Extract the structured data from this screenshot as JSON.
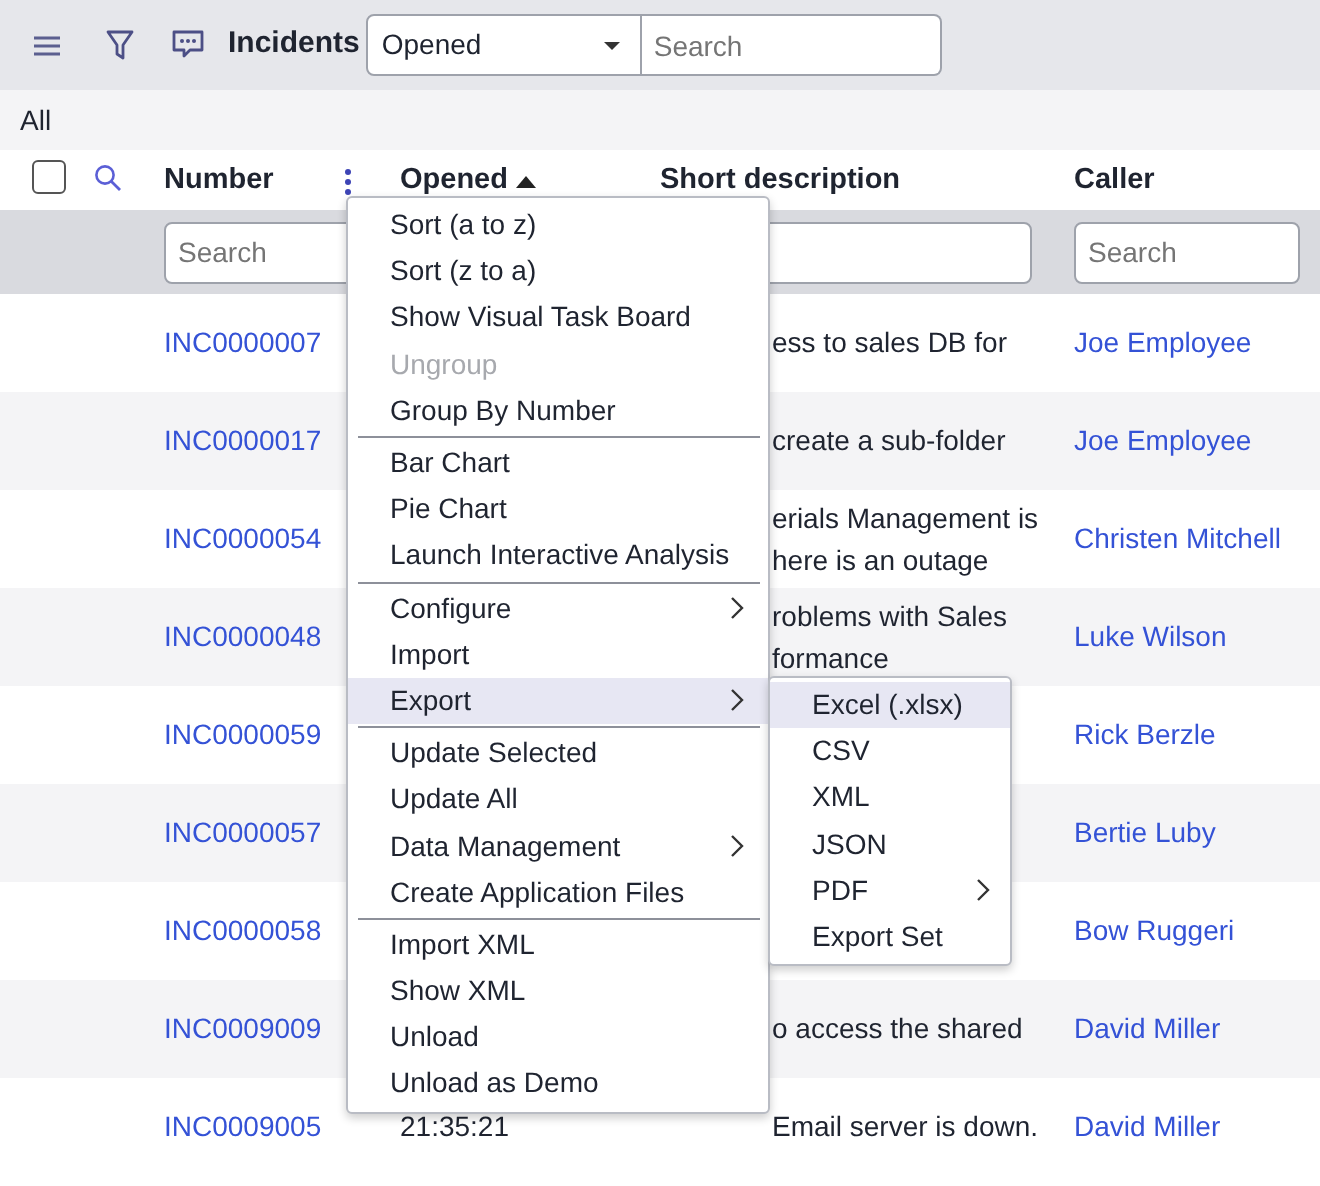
{
  "toolbar": {
    "title": "Incidents",
    "field_select": {
      "value": "Opened"
    },
    "search": {
      "placeholder": "Search"
    }
  },
  "breadcrumb": "All",
  "table": {
    "select_all": {
      "checked": false
    },
    "columns": [
      {
        "label": "Number",
        "sorted": false,
        "filter_placeholder": "Search"
      },
      {
        "label": "Opened",
        "sorted": true
      },
      {
        "label": "Short description",
        "sorted": false
      },
      {
        "label": "Caller",
        "sorted": false,
        "filter_placeholder": "Search"
      }
    ],
    "rows": [
      {
        "number": "INC0000007",
        "description": [
          "ess to sales DB for"
        ],
        "caller": "Joe Employee"
      },
      {
        "number": "INC0000017",
        "description": [
          "create a sub-folder"
        ],
        "caller": "Joe Employee"
      },
      {
        "number": "INC0000054",
        "description": [
          "erials Management is",
          "here is an outage"
        ],
        "caller": "Christen Mitchell"
      },
      {
        "number": "INC0000048",
        "description": [
          "roblems with Sales",
          "formance"
        ],
        "caller": "Luke Wilson"
      },
      {
        "number": "INC0000059",
        "caller": "Rick Berzle"
      },
      {
        "number": "INC0000057",
        "caller": "Bertie Luby"
      },
      {
        "number": "INC0000058",
        "caller": "Bow Ruggeri"
      },
      {
        "number": "INC0009009",
        "description": [
          "o access the shared"
        ],
        "caller": "David Miller"
      },
      {
        "number": "INC0009005",
        "opened": "21:35:21",
        "description": [
          "Email server is down."
        ],
        "caller": "David Miller"
      }
    ]
  },
  "context_menu": {
    "items": [
      {
        "label": "Sort (a to z)",
        "disabled": false,
        "submenu": false,
        "selected": false
      },
      {
        "label": "Sort (z to a)",
        "disabled": false,
        "submenu": false,
        "selected": false
      },
      {
        "label": "Show Visual Task Board",
        "disabled": false,
        "submenu": false,
        "selected": false
      },
      {
        "label": "Ungroup",
        "disabled": true,
        "submenu": false,
        "selected": false
      },
      {
        "label": "Group By Number",
        "disabled": false,
        "submenu": false,
        "selected": false
      },
      {
        "kind": "divider"
      },
      {
        "label": "Bar Chart",
        "disabled": false,
        "submenu": false,
        "selected": false
      },
      {
        "label": "Pie Chart",
        "disabled": false,
        "submenu": false,
        "selected": false
      },
      {
        "label": "Launch Interactive Analysis",
        "disabled": false,
        "submenu": false,
        "selected": false
      },
      {
        "kind": "divider"
      },
      {
        "label": "Configure",
        "disabled": false,
        "submenu": true,
        "selected": false
      },
      {
        "label": "Import",
        "disabled": false,
        "submenu": false,
        "selected": false
      },
      {
        "label": "Export",
        "disabled": false,
        "submenu": true,
        "selected": true,
        "children": [
          {
            "label": "Excel (.xlsx)",
            "submenu": false,
            "selected": true
          },
          {
            "label": "CSV",
            "submenu": false,
            "selected": false
          },
          {
            "label": "XML",
            "submenu": false,
            "selected": false
          },
          {
            "label": "JSON",
            "submenu": false,
            "selected": false
          },
          {
            "label": "PDF",
            "submenu": true,
            "selected": false
          },
          {
            "label": "Export Set",
            "submenu": false,
            "selected": false
          }
        ]
      },
      {
        "kind": "divider"
      },
      {
        "label": "Update Selected",
        "disabled": false,
        "submenu": false,
        "selected": false
      },
      {
        "label": "Update All",
        "disabled": false,
        "submenu": false,
        "selected": false
      },
      {
        "label": "Data Management",
        "disabled": false,
        "submenu": true,
        "selected": false
      },
      {
        "label": "Create Application Files",
        "disabled": false,
        "submenu": false,
        "selected": false
      },
      {
        "kind": "divider"
      },
      {
        "label": "Import XML",
        "disabled": false,
        "submenu": false,
        "selected": false
      },
      {
        "label": "Show XML",
        "disabled": false,
        "submenu": false,
        "selected": false
      },
      {
        "label": "Unload",
        "disabled": false,
        "submenu": false,
        "selected": false
      },
      {
        "label": "Unload as Demo",
        "disabled": false,
        "submenu": false,
        "selected": false
      }
    ]
  }
}
